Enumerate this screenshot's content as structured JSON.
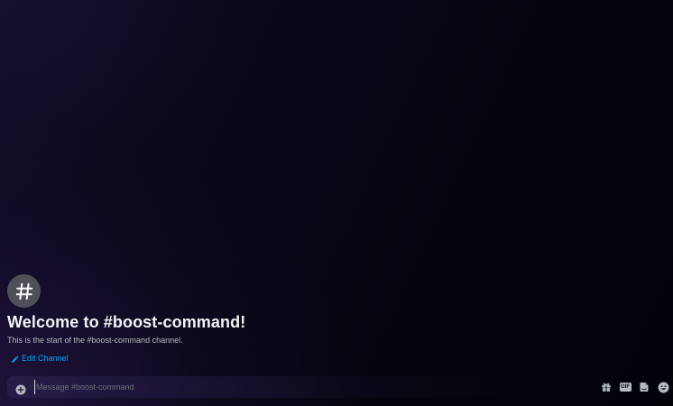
{
  "channel": {
    "name": "boost-command",
    "welcome_title": "Welcome to #boost-command!",
    "welcome_subtitle": "This is the start of the #boost-command channel.",
    "edit_label": "Edit Channel"
  },
  "composer": {
    "placeholder": "Message #boost-command",
    "value": ""
  },
  "icons": {
    "channel": "hashtag-icon",
    "edit": "pencil-icon",
    "attach": "plus-circle-icon",
    "gift": "gift-icon",
    "gif": "gif-icon",
    "sticker": "sticker-icon",
    "emoji": "emoji-icon"
  },
  "colors": {
    "link": "#00a8fc",
    "title": "#f2f3f5",
    "muted": "#b5bac1",
    "icon_circle": "#4e5058"
  }
}
